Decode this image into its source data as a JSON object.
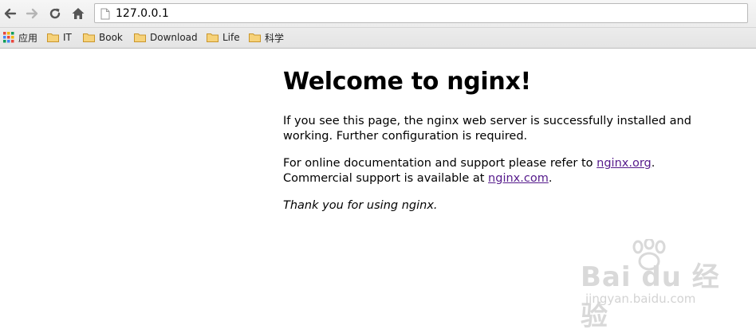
{
  "browser": {
    "url": "127.0.0.1",
    "bookmarks": [
      {
        "label": "应用",
        "icon": "apps-grid-icon"
      },
      {
        "label": "IT",
        "icon": "folder-icon"
      },
      {
        "label": "Book",
        "icon": "folder-icon"
      },
      {
        "label": "Download",
        "icon": "folder-icon"
      },
      {
        "label": "Life",
        "icon": "folder-icon"
      },
      {
        "label": "科学",
        "icon": "folder-icon"
      }
    ]
  },
  "page": {
    "heading": "Welcome to nginx!",
    "para1": "If you see this page, the nginx web server is successfully installed and working. Further configuration is required.",
    "para2_prefix": "For online documentation and support please refer to ",
    "link_org": "nginx.org",
    "para2_mid": ".",
    "para2_line2": "Commercial support is available at ",
    "link_com": "nginx.com",
    "para2_end": ".",
    "para3": "Thank you for using nginx."
  },
  "watermark": {
    "main": "Bai du 经验",
    "sub": "jingyan.baidu.com"
  },
  "colors": {
    "link": "#551a8b",
    "folder": "#f2c14e"
  }
}
